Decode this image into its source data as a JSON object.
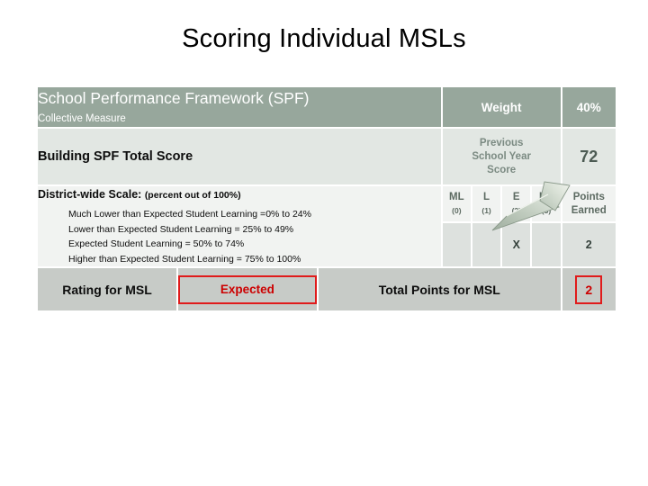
{
  "slide": {
    "title": "Scoring Individual MSLs"
  },
  "table": {
    "header": {
      "measure_title": "School Performance Framework (SPF)",
      "measure_subtitle": "Collective Measure",
      "weight_label": "Weight",
      "weight_value": "40%"
    },
    "total_row": {
      "building_label": "Building SPF Total Score",
      "previous_label_line1": "Previous",
      "previous_label_line2": "School Year",
      "previous_label_line3": "Score",
      "previous_score": "72"
    },
    "scale": {
      "heading": "District-wide Scale:",
      "heading_paren": "(percent out of 100%)",
      "items": [
        "Much Lower than Expected Student Learning =0% to 24%",
        "Lower than Expected Student Learning = 25% to 49%",
        "Expected Student Learning = 50% to 74%",
        "Higher than Expected Student Learning = 75% to 100%"
      ]
    },
    "rating_columns": [
      {
        "level": "ML",
        "number": "(0)",
        "mark": ""
      },
      {
        "level": "L",
        "number": "(1)",
        "mark": ""
      },
      {
        "level": "E",
        "number": "(2)",
        "mark": "X"
      },
      {
        "level": "HE",
        "number": "(3)",
        "mark": ""
      }
    ],
    "points_earned": {
      "label_line1": "Points",
      "label_line2": "Earned",
      "value": "2"
    },
    "footer": {
      "rating_label": "Rating for MSL",
      "rating_value": "Expected",
      "total_points_label": "Total Points for MSL",
      "total_points_value": "2"
    }
  },
  "graphics": {
    "arrow_icon": "up-right-arrow-3d"
  },
  "colors": {
    "header_green": "#97a79c",
    "row_light": "#e2e7e3",
    "row_lighter": "#f1f3f1",
    "row_marks": "#dde1de",
    "footer_gray": "#c7cbc7",
    "accent_red": "#e01b1b",
    "text_red": "#cc0000"
  }
}
